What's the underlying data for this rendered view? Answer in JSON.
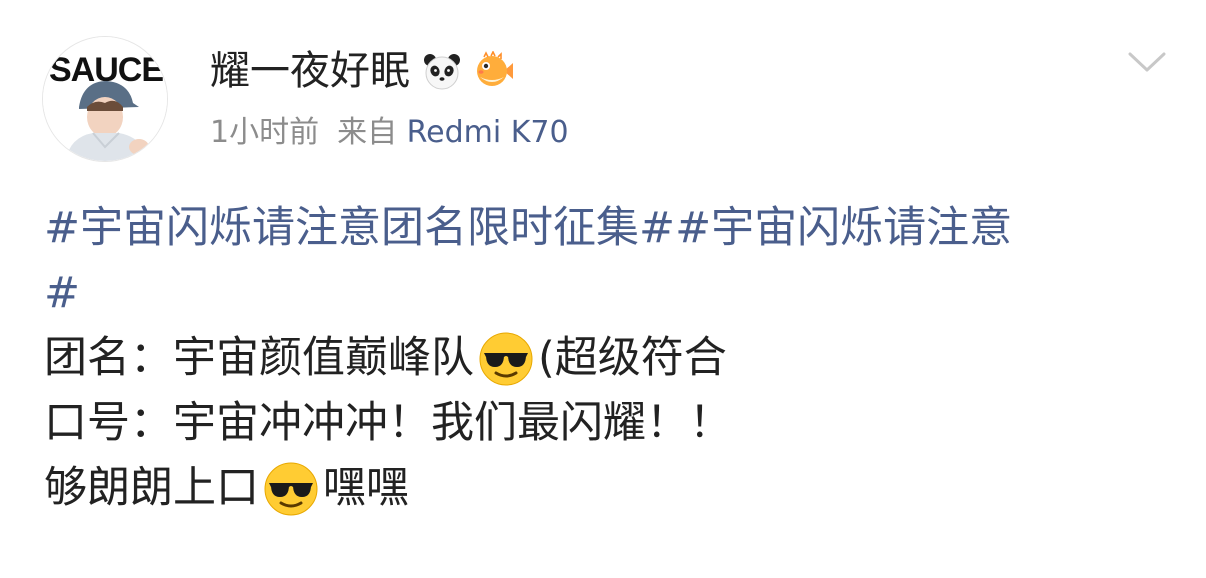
{
  "post": {
    "avatar_text": "SAUCE",
    "username": "耀一夜好眠",
    "badges": [
      "panda-icon",
      "pufferfish-icon"
    ],
    "time": "1小时前",
    "source_prefix": "来自",
    "device": "Redmi K70"
  },
  "content": {
    "topic1": "#宇宙闪烁请注意团名限时征集#",
    "topic2_line1": "#宇宙闪烁请注意",
    "topic2_line2": "#",
    "line3_text": "团名：宇宙颜值巅峰队",
    "line3_tail": "(超级符合",
    "line4_text": "口号：宇宙冲冲冲！我们最闪耀！！",
    "line5_text": "够朗朗上口",
    "line5_tail": "嘿嘿",
    "emoji_name": "sunglasses-emoji-icon"
  },
  "colors": {
    "link": "#4a5e8c",
    "text": "#222222",
    "meta": "#8c8c8c",
    "chevron": "#c8c8c8"
  }
}
